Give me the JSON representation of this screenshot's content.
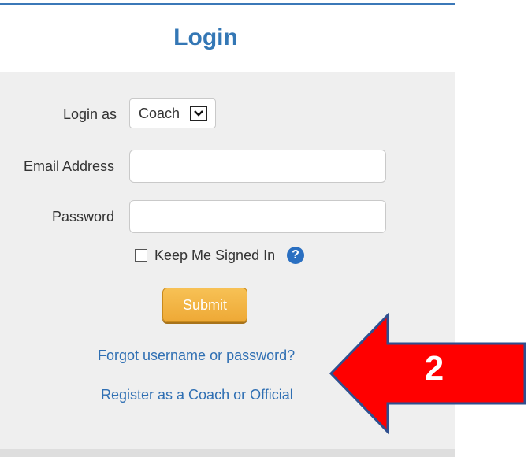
{
  "page": {
    "title": "Login"
  },
  "form": {
    "login_as_label": "Login as",
    "login_as_value": "Coach",
    "email_label": "Email Address",
    "email_value": "",
    "password_label": "Password",
    "password_value": "",
    "keep_signed_in_label": "Keep Me Signed In",
    "keep_signed_in_checked": false,
    "help_glyph": "?",
    "submit_label": "Submit"
  },
  "links": {
    "forgot": "Forgot username or password?",
    "register": "Register as a Coach or Official"
  },
  "annotation": {
    "number": "2",
    "arrow_color": "#ff0000",
    "arrow_outline_color": "#2f4f8f"
  },
  "colors": {
    "title": "#3477b5",
    "link": "#2f6fb3",
    "submit": "#eea936",
    "help_icon": "#2a6fc1",
    "panel_background": "#efefef"
  }
}
